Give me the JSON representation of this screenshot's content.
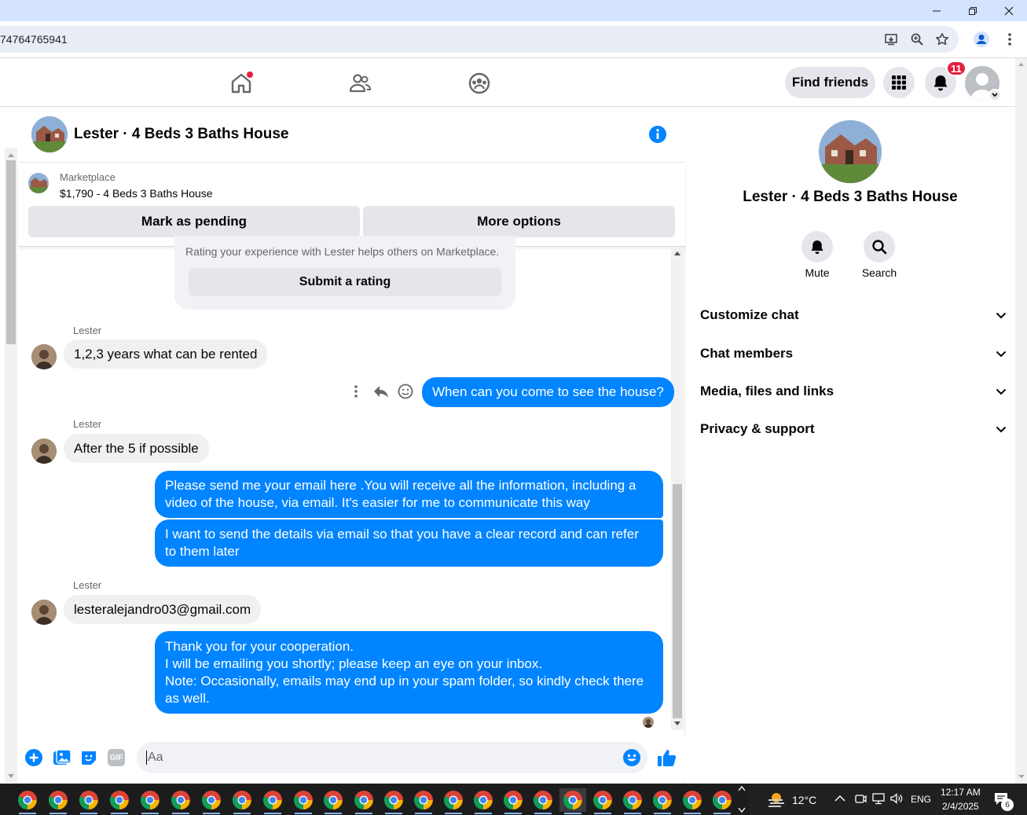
{
  "browser": {
    "url": "74764765941"
  },
  "header": {
    "find_friends_label": "Find friends",
    "notification_count": "11"
  },
  "chat": {
    "title": "Lester · 4 Beds 3 Baths House",
    "marketplace_label": "Marketplace",
    "listing": "$1,790 - 4 Beds 3 Baths House",
    "mark_pending_label": "Mark as pending",
    "more_options_label": "More options",
    "rating_text": "Rating your experience with Lester helps others on Marketplace.",
    "submit_rating_label": "Submit a rating",
    "messages": [
      {
        "sender": "Lester",
        "text": "1,2,3 years what can be rented"
      },
      {
        "text": "When can you come to see the house?"
      },
      {
        "sender": "Lester",
        "text": "After the 5 if possible"
      },
      {
        "text": "Please send me your email here .You will receive all the information, including a video of the house, via email. It's easier for me to communicate this way"
      },
      {
        "text": "I want to send the details via email so that you have a clear record and can refer to them later"
      },
      {
        "sender": "Lester",
        "text": "lesteralejandro03@gmail.com"
      },
      {
        "lines": [
          "Thank you for your cooperation.",
          "I will be emailing you shortly; please keep an eye on your inbox.",
          "Note: Occasionally, emails may end up in your spam folder, so kindly check there as well."
        ]
      }
    ],
    "composer_placeholder": "Aa",
    "gif_label": "GIF"
  },
  "right_panel": {
    "title": "Lester · 4 Beds 3 Baths House",
    "mute_label": "Mute",
    "search_label": "Search",
    "sections": [
      "Customize chat",
      "Chat members",
      "Media, files and links",
      "Privacy & support"
    ]
  },
  "taskbar": {
    "temperature": "12°C",
    "language": "ENG",
    "time": "12:17 AM",
    "date": "2/4/2025",
    "notification_count": "6"
  },
  "colors": {
    "accent": "#0084ff",
    "badge": "#e41e3f",
    "bubble_in": "#f0f0f0"
  }
}
